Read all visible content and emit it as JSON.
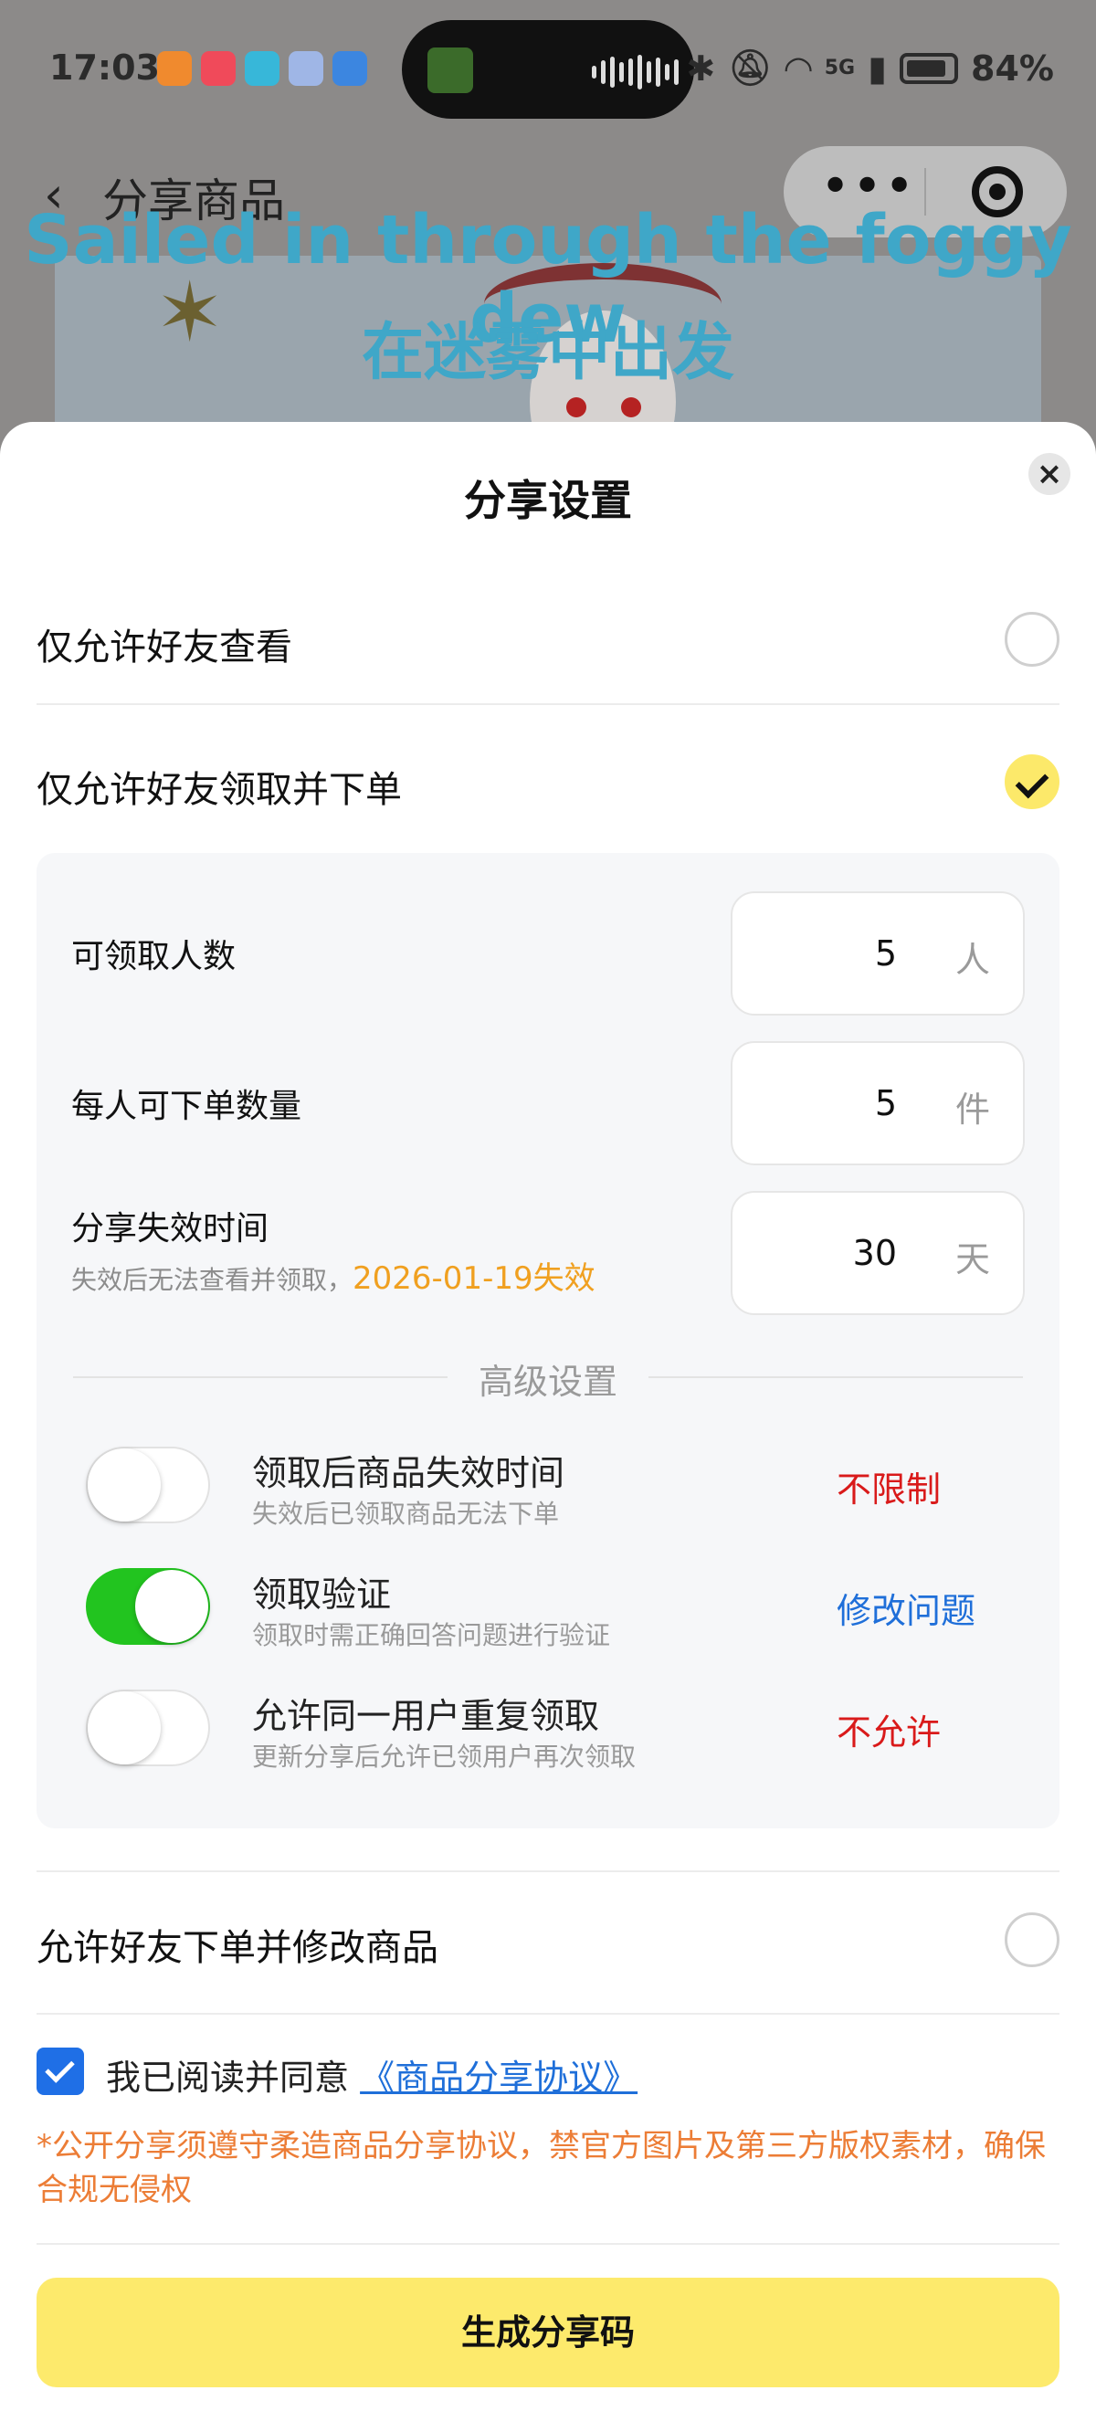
{
  "status_bar": {
    "time": "17:03",
    "network": "5G",
    "battery": "84%"
  },
  "nav": {
    "title": "分享商品"
  },
  "lyrics": {
    "english": "Sailed in through the foggy dew",
    "chinese": "在迷雾中出发"
  },
  "sheet": {
    "title": "分享设置",
    "options": [
      {
        "label": "仅允许好友查看",
        "selected": false
      },
      {
        "label": "仅允许好友领取并下单",
        "selected": true
      },
      {
        "label": "允许好友下单并修改商品",
        "selected": false
      }
    ],
    "fields": {
      "claim_count": {
        "label": "可领取人数",
        "value": "5",
        "unit": "人"
      },
      "order_qty": {
        "label": "每人可下单数量",
        "value": "5",
        "unit": "件"
      },
      "expiry": {
        "label": "分享失效时间",
        "sub": "失效后无法查看并领取，",
        "expire_date": "2026-01-19失效",
        "value": "30",
        "unit": "天"
      }
    },
    "advanced_title": "高级设置",
    "toggles": [
      {
        "label": "领取后商品失效时间",
        "sub": "失效后已领取商品无法下单",
        "action": "不限制",
        "on": false
      },
      {
        "label": "领取验证",
        "sub": "领取时需正确回答问题进行验证",
        "action": "修改问题",
        "on": true
      },
      {
        "label": "允许同一用户重复领取",
        "sub": "更新分享后允许已领用户再次领取",
        "action": "不允许",
        "on": false
      }
    ],
    "agreement": {
      "checked": true,
      "text": "我已阅读并同意 ",
      "link": "《商品分享协议》"
    },
    "notice": "*公开分享须遵守柔造商品分享协议，禁官方图片及第三方版权素材，确保合规无侵权",
    "generate_button": "生成分享码"
  },
  "colors": {
    "accent_yellow": "#fdea6c",
    "toggle_green": "#22c41f",
    "link_blue": "#1f6fd9",
    "warning_red": "#d91a1a",
    "notice_orange": "#ec7d36",
    "expire_orange": "#f0a020"
  }
}
